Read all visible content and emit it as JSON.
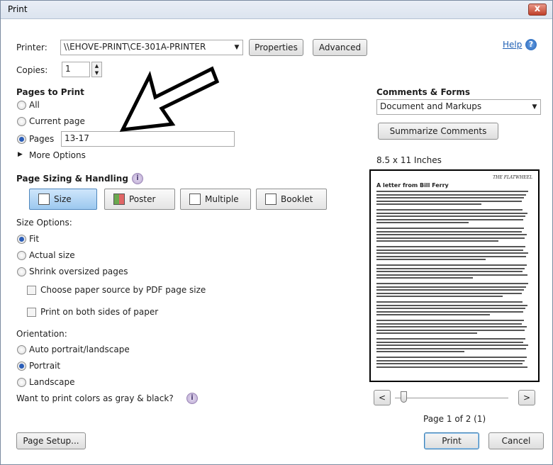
{
  "window": {
    "title": "Print",
    "close_glyph": "x"
  },
  "printer": {
    "label": "Printer:",
    "value": "\\\\EHOVE-PRINT\\CE-301A-PRINTER",
    "properties_label": "Properties",
    "advanced_label": "Advanced",
    "help_label": "Help",
    "help_icon": "?"
  },
  "copies": {
    "label": "Copies:",
    "value": "1"
  },
  "pages_to_print": {
    "heading": "Pages to Print",
    "all_label": "All",
    "current_label": "Current page",
    "pages_label": "Pages",
    "pages_value": "13-17",
    "selected": "Pages",
    "more_options_label": "More Options"
  },
  "sizing": {
    "heading": "Page Sizing & Handling",
    "info_icon": "i",
    "tabs": [
      {
        "label": "Size",
        "active": true
      },
      {
        "label": "Poster",
        "active": false
      },
      {
        "label": "Multiple",
        "active": false
      },
      {
        "label": "Booklet",
        "active": false
      }
    ],
    "size_options_label": "Size Options:",
    "fit_label": "Fit",
    "actual_label": "Actual size",
    "shrink_label": "Shrink oversized pages",
    "selected_size": "Fit",
    "paper_source_label": "Choose paper source by PDF page size",
    "both_sides_label": "Print on both sides of paper"
  },
  "orientation": {
    "label": "Orientation:",
    "auto_label": "Auto portrait/landscape",
    "portrait_label": "Portrait",
    "landscape_label": "Landscape",
    "selected": "Portrait"
  },
  "gray": {
    "label": "Want to print colors as gray & black?",
    "info_icon": "i"
  },
  "comments": {
    "heading": "Comments & Forms",
    "value": "Document and Markups",
    "summarize_label": "Summarize Comments"
  },
  "preview": {
    "paper_size": "8.5 x 11 Inches",
    "header_right": "THE FLATWHEEL",
    "doc_title": "A letter from Bill Ferry",
    "page_text": "Page 1 of 2 (1)",
    "prev_label": "<",
    "next_label": ">",
    "slider_position": 0
  },
  "footer": {
    "page_setup_label": "Page Setup...",
    "print_label": "Print",
    "cancel_label": "Cancel"
  },
  "colors": {
    "accent": "#2a5db8",
    "close": "#c0402a",
    "help": "#1e5fb4"
  }
}
